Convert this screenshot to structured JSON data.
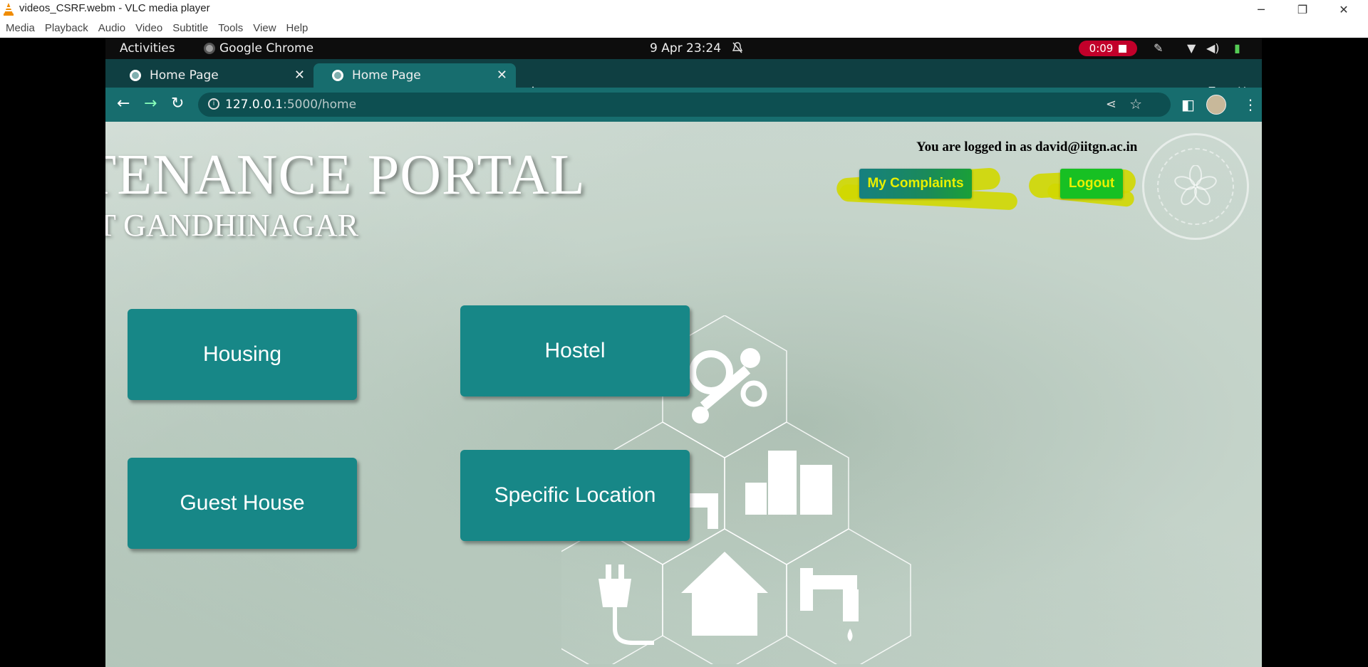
{
  "vlc": {
    "title": "videos_CSRF.webm - VLC media player",
    "menu": [
      "Media",
      "Playback",
      "Audio",
      "Video",
      "Subtitle",
      "Tools",
      "View",
      "Help"
    ]
  },
  "gnome": {
    "activities": "Activities",
    "app": "Google Chrome",
    "clock": "9 Apr  23:24",
    "recording": "0:09"
  },
  "browser": {
    "tabs": [
      {
        "title": "Home Page",
        "active": false
      },
      {
        "title": "Home Page",
        "active": true
      }
    ],
    "url_host": "127.0.0.1",
    "url_path": ":5000/home"
  },
  "page": {
    "title": "INTENANCE PORTAL",
    "subtitle": "T GANDHINAGAR",
    "logged_in_prefix": "You are logged in as ",
    "user_email": "david@iitgn.ac.in",
    "my_complaints": "My Complaints",
    "logout": "Logout",
    "tiles": {
      "housing": "Housing",
      "hostel": "Hostel",
      "guest_house": "Guest House",
      "specific_location": "Specific Location"
    }
  },
  "colors": {
    "accent": "#178787",
    "browser_frame": "#176d6e",
    "highlight": "#d0d800",
    "logout_button": "#17c023"
  }
}
